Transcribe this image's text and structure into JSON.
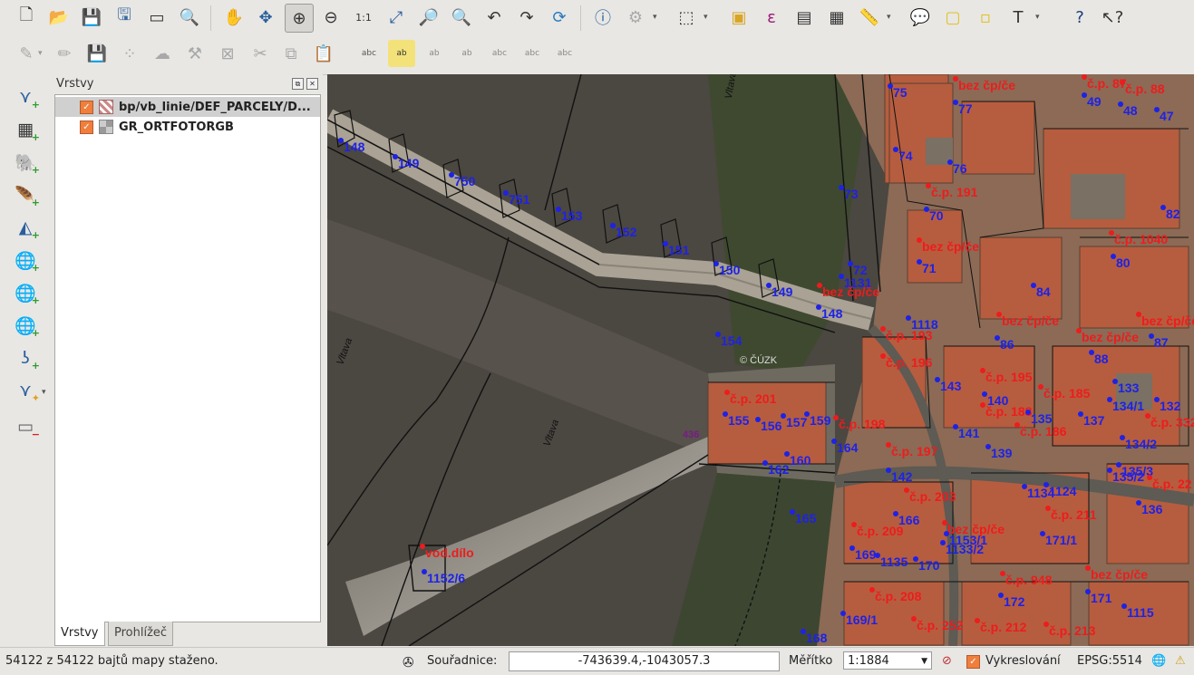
{
  "toolbar1": {
    "icons": [
      "new-project-icon",
      "open-project-icon",
      "save-project-icon",
      "save-as-icon",
      "new-print-composer-icon",
      "composer-manager-icon",
      "pan-icon",
      "pan-to-selection-icon",
      "zoom-in-icon",
      "zoom-out-icon",
      "zoom-actual-size-icon",
      "zoom-full-icon",
      "zoom-to-selection-icon",
      "zoom-to-layer-icon",
      "zoom-last-icon",
      "zoom-next-icon",
      "refresh-icon",
      "identify-icon",
      "action-icon",
      "select-features-icon",
      "deselect-icon",
      "expression-select-icon",
      "attribute-table-icon",
      "statistics-icon",
      "measure-icon",
      "annotation-icon",
      "text-annotation-icon",
      "form-annotation-icon",
      "label-icon",
      "help-icon",
      "whats-this-icon"
    ]
  },
  "toolbar2": {
    "icons": [
      "digitize-pencil-icon",
      "toggle-editing-icon",
      "save-edits-icon",
      "add-feature-icon",
      "move-feature-icon",
      "node-tool-icon",
      "delete-selected-icon",
      "cut-features-icon",
      "copy-features-icon",
      "paste-features-icon",
      "label-abc-icon",
      "label-highlight-icon",
      "pin-label-icon",
      "show-hide-label-icon",
      "move-label-icon",
      "rotate-label-icon",
      "change-label-icon"
    ]
  },
  "vertical_toolbar": {
    "icons": [
      "add-vector-layer-icon",
      "add-raster-layer-icon",
      "add-postgis-layer-icon",
      "add-spatialite-layer-icon",
      "add-mssql-layer-icon",
      "add-wms-layer-icon",
      "add-wcs-layer-icon",
      "add-wfs-layer-icon",
      "add-delimited-text-layer-icon",
      "new-shapefile-layer-icon",
      "remove-layer-icon"
    ]
  },
  "layers_panel": {
    "title": "Vrstvy",
    "layers": [
      {
        "name": "bp/vb_linie/DEF_PARCELY/D...",
        "checked": true,
        "selected": true
      },
      {
        "name": "GR_ORTFOTORGB",
        "checked": true,
        "selected": false
      }
    ],
    "tabs": [
      "Vrstvy",
      "Prohlížeč"
    ],
    "active_tab": "Vrstvy"
  },
  "map": {
    "watermark": "© ČÚZK",
    "river_labels": [
      "Vltava",
      "Vltava",
      "Vltava"
    ],
    "parcel_labels_blue": [
      "148",
      "149",
      "750",
      "751",
      "153",
      "152",
      "151",
      "150",
      "149",
      "148",
      "75",
      "77",
      "74",
      "76",
      "73",
      "70",
      "72",
      "1131",
      "71",
      "84",
      "82",
      "80",
      "49",
      "48",
      "47",
      "1118",
      "154",
      "86",
      "87",
      "88",
      "140",
      "143",
      "141",
      "139",
      "135",
      "137",
      "132",
      "133",
      "134/1",
      "155",
      "156",
      "157",
      "159",
      "164",
      "160",
      "162",
      "165",
      "142",
      "166",
      "1134",
      "135/2",
      "1153/1",
      "171/1",
      "1133/2",
      "1135",
      "170",
      "169",
      "172",
      "171",
      "1115",
      "169/1",
      "168",
      "1152/6",
      "1124",
      "136",
      "134/2",
      "135/3"
    ],
    "parcel_labels_red": [
      "bez čp/če",
      "č.p. 87",
      "č.p. 88",
      "č.p. 191",
      "bez čp/če",
      "č.p. 1040",
      "bez čp/če",
      "bez čp/če",
      "bez čp/če",
      "bez čp/če",
      "č.p. 193",
      "č.p. 196",
      "č.p. 195",
      "č.p. 188",
      "č.p. 185",
      "č.p. 201",
      "č.p. 198",
      "č.p. 186",
      "č.p. 197",
      "č.p. 203",
      "č.p. 209",
      "bez čp/če",
      "č.p. 211",
      "č.p. 948",
      "bez čp/če",
      "č.p. 208",
      "č.p. 252",
      "č.p. 212",
      "č.p. 213",
      "vod.dílo",
      "č.p. 332",
      "č.p. 22"
    ],
    "parcel_labels_purple": [
      "436"
    ]
  },
  "status_bar": {
    "message": "54122 z 54122 bajtů mapy staženo.",
    "coord_label": "Souřadnice:",
    "coord_value": "-743639.4,-1043057.3",
    "scale_label": "Měřítko",
    "scale_value": "1:1884",
    "render_label": "Vykreslování",
    "render_checked": true,
    "crs": "EPSG:5514"
  },
  "colors": {
    "accent_checkbox": "#f07e3c",
    "label_blue": "#1e22e6",
    "label_red": "#ee1c1c",
    "roof": "#b65d3f",
    "river": "#4b4741"
  }
}
